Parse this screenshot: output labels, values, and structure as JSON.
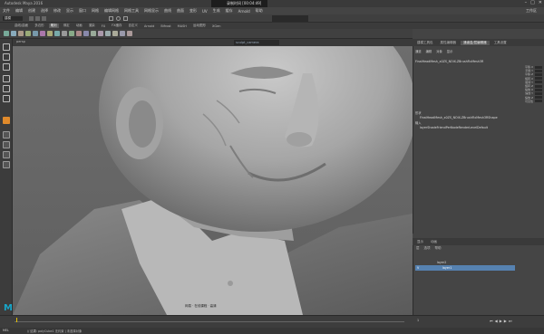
{
  "title_bar": {
    "title": "Autodesk Maya 2016",
    "recording_label": "录制时间 [00:04:49]",
    "window_controls": [
      "minimize-icon",
      "maximize-icon",
      "close-icon"
    ]
  },
  "menu": {
    "items": [
      "文件",
      "编辑",
      "创建",
      "选择",
      "修改",
      "显示",
      "窗口",
      "网格",
      "编辑网格",
      "网格工具",
      "网格显示",
      "曲线",
      "曲面",
      "变形",
      "UV",
      "生成",
      "缓存",
      "Arnold",
      "帮助"
    ],
    "workspace_label": "工作区"
  },
  "status_line": {
    "mode": "建模",
    "snap_icons": [
      "grid-snap-icon",
      "curve-snap-icon",
      "point-snap-icon"
    ]
  },
  "shelf": {
    "tabs": [
      "曲线/曲面",
      "多边形",
      "雕刻",
      "绑定",
      "动画",
      "渲染",
      "FX",
      "FX缓存",
      "自定义",
      "Arnold",
      "Bifrost",
      "MASH",
      "运动图形",
      "XGen"
    ],
    "active_tab": "雕刻"
  },
  "viewport": {
    "panel_label": "persp",
    "camera_field": "sculpt_camera",
    "watermark": "网易 · 在线课程 · 高清"
  },
  "channel_box": {
    "tabs": [
      "通道盒/层编辑器",
      "建模工具包",
      "属性编辑器",
      "工具设置"
    ],
    "active_tab": "通道盒/层编辑器",
    "menu": [
      "通道",
      "编辑",
      "对象",
      "显示"
    ],
    "object_name": "FinalHeadMesh_x0ZS_NOIX-ZBrushFixMesh3R",
    "attributes": [
      "平移 X",
      "平移 Y",
      "平移 Z",
      "旋转 X",
      "旋转 Y",
      "旋转 Z",
      "缩放 X",
      "缩放 Y",
      "缩放 Z",
      "可见性"
    ],
    "shapes_label": "形状",
    "shape_name": "FinalHeadMesh_x0ZS_NOIX-ZBrushFixMesh3RShape",
    "inputs_label": "输入",
    "input_name": "layerShadeFriendPerNodeRenderLevelDefault"
  },
  "layer_editor": {
    "tabs": [
      "显示",
      "动画"
    ],
    "menu": [
      "层",
      "选项",
      "帮助"
    ],
    "layers": [
      {
        "name": "layer2",
        "visible": "",
        "selected": false
      },
      {
        "name": "layer1",
        "visible": "V",
        "selected": true
      }
    ]
  },
  "timeline": {
    "start": "1",
    "end": "120",
    "current": "1",
    "ticks": [
      "5",
      "10",
      "15",
      "20",
      "25",
      "30",
      "35",
      "40",
      "45",
      "50",
      "55",
      "60",
      "65",
      "70",
      "75",
      "80",
      "85",
      "90",
      "95",
      "100",
      "105",
      "110",
      "115",
      "120"
    ]
  },
  "command_line": {
    "label": "MEL",
    "text": "// 结果: polyCube1 无约束 | 未选择对象"
  },
  "branding": {
    "logo": "M"
  }
}
